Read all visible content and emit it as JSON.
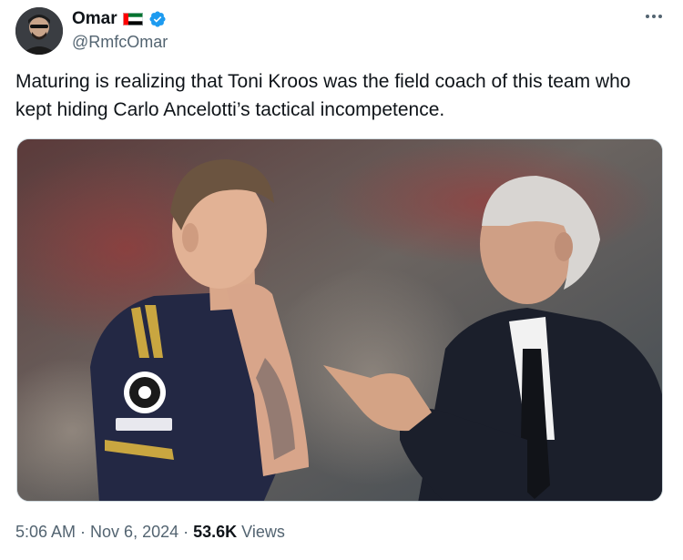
{
  "author": {
    "display_name": "Omar",
    "handle": "@RmfcOmar",
    "avatar_icon": "avatar-photo",
    "flag_icon": "uae-flag-icon",
    "verified_icon": "verified-badge-icon",
    "verified_color": "#1d9bf0"
  },
  "tweet": {
    "text": "Maturing is realizing that Toni Kroos was the field coach of this team who kept hiding Carlo Ancelotti’s tactical incompetence.",
    "media_icon": "photo-toni-kroos-and-carlo-ancelotti"
  },
  "meta": {
    "time": "5:06 AM",
    "separator1": "·",
    "date": "Nov 6, 2024",
    "separator2": "·",
    "views_count": "53.6K",
    "views_label": "Views"
  },
  "more_icon": "more-options-icon",
  "colors": {
    "text": "#0f1419",
    "secondary": "#536471",
    "border": "#cfd9de"
  }
}
